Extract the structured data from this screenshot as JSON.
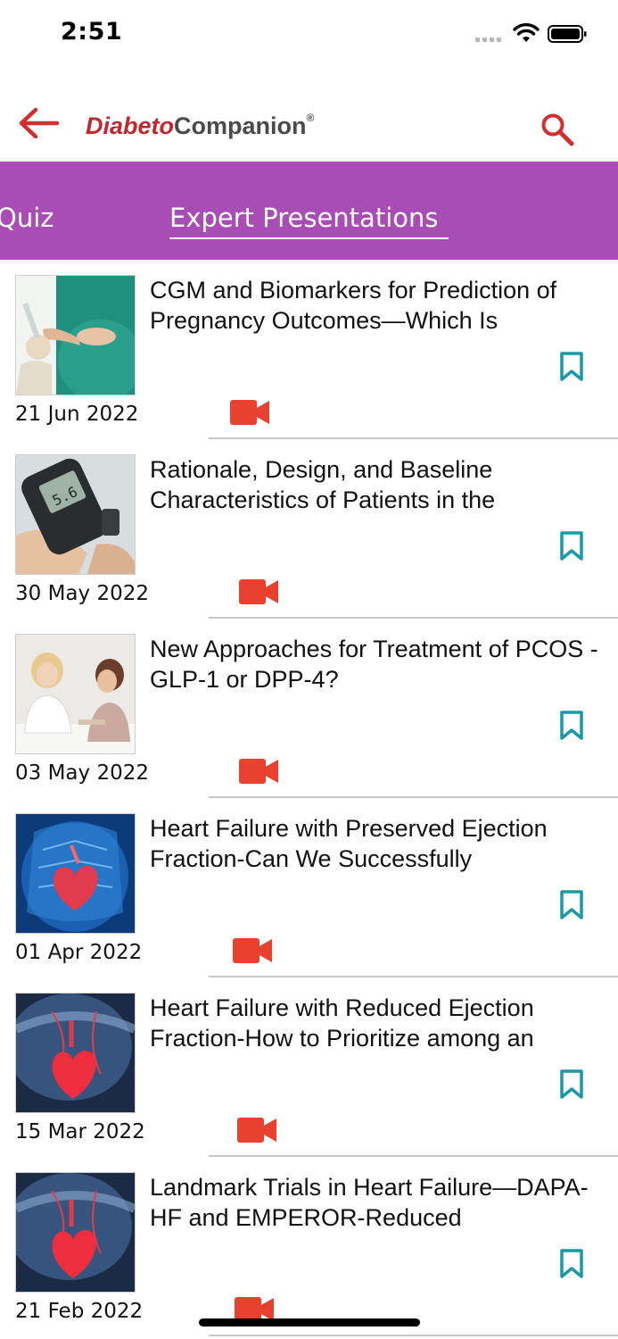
{
  "status_bar": {
    "time": "2:51"
  },
  "header": {
    "logo_part1": "Diabeto",
    "logo_part2": "Companion",
    "logo_mark": "®"
  },
  "tabs": {
    "previous_partial": "Quiz",
    "active": "Expert Presentations"
  },
  "colors": {
    "tab_bar": "#a94cb5",
    "accent_red": "#e8412f",
    "bookmark_teal": "#1a98a6",
    "logo_red": "#c3262f"
  },
  "items": [
    {
      "title": "CGM and Biomarkers for Prediction of Pregnancy Outcomes—Which Is",
      "date": "21 Jun 2022",
      "thumb": "pregnancy-glucose-test"
    },
    {
      "title": "Rationale, Design, and Baseline Characteristics of Patients in the",
      "date": "30 May 2022",
      "thumb": "glucometer"
    },
    {
      "title": "New Approaches for Treatment of PCOS - GLP-1 or DPP-4?",
      "date": "03 May 2022",
      "thumb": "doctor-consultation"
    },
    {
      "title": "Heart Failure with Preserved Ejection Fraction-Can We Successfully",
      "date": "01 Apr 2022",
      "thumb": "heart-blue"
    },
    {
      "title": "Heart Failure with Reduced Ejection Fraction-How to Prioritize among an",
      "date": "15 Mar 2022",
      "thumb": "heart-dark"
    },
    {
      "title": "Landmark Trials in Heart Failure—DAPA-HF and EMPEROR-Reduced",
      "date": "21 Feb 2022",
      "thumb": "heart-dark"
    }
  ]
}
